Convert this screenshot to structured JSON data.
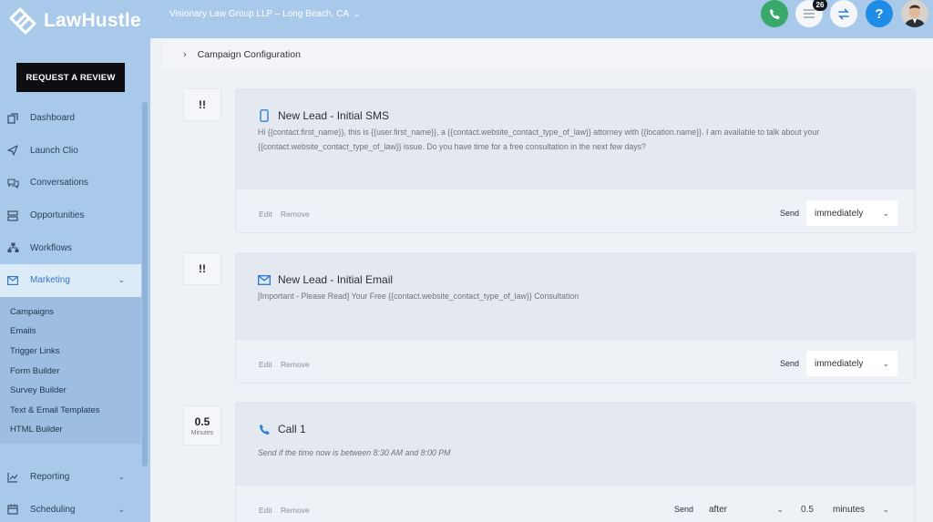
{
  "brand": {
    "name": "LawHustle"
  },
  "review_button": "REQUEST A REVIEW",
  "company": {
    "name": "Visionary Law Group LLP – Long Beach, CA"
  },
  "notifications": {
    "count": "26"
  },
  "help": {
    "label": "?"
  },
  "nav": {
    "items": [
      {
        "label": "Dashboard",
        "icon": "dashboard-icon"
      },
      {
        "label": "Launch Clio",
        "icon": "send-icon"
      },
      {
        "label": "Conversations",
        "icon": "chat-icon"
      },
      {
        "label": "Opportunities",
        "icon": "stack-icon"
      },
      {
        "label": "Workflows",
        "icon": "workflow-icon"
      },
      {
        "label": "Marketing",
        "icon": "mail-icon"
      }
    ],
    "marketing_sub": [
      "Campaigns",
      "Emails",
      "Trigger Links",
      "Form Builder",
      "Survey Builder",
      "Text & Email Templates",
      "HTML Builder"
    ],
    "bottom": [
      {
        "label": "Reporting",
        "icon": "chart-icon"
      },
      {
        "label": "Scheduling",
        "icon": "calendar-icon"
      }
    ]
  },
  "config": {
    "label": "Campaign Configuration"
  },
  "steps": [
    {
      "marker": "!!",
      "title": "New Lead - Initial SMS",
      "icon": "phone-sms-icon",
      "body": "Hi {{contact.first_name}}, this is {{user.first_name}}, a {{contact.website_contact_type_of_law}} attorney with {{location.name}}. I am available to talk about your {{contact.website_contact_type_of_law}} issue. Do you have time for a free consultation in the next few days?",
      "edit": "Edit",
      "remove": "Remove",
      "send_label": "Send",
      "send_value": "immediately"
    },
    {
      "marker": "!!",
      "title": "New Lead - Initial Email",
      "icon": "envelope-icon",
      "body": "[Important - Please Read] Your Free {{contact.website_contact_type_of_law}} Consultation",
      "edit": "Edit",
      "remove": "Remove",
      "send_label": "Send",
      "send_value": "immediately"
    },
    {
      "marker": "0.5",
      "marker_unit": "Minutes",
      "title": "Call 1",
      "icon": "call-icon",
      "body": "Send if the time now is between 8:30 AM and 8:00 PM",
      "edit": "Edit",
      "remove": "Remove",
      "send_label": "Send",
      "send_value": "after",
      "delay_value": "0.5",
      "delay_unit": "minutes"
    }
  ]
}
